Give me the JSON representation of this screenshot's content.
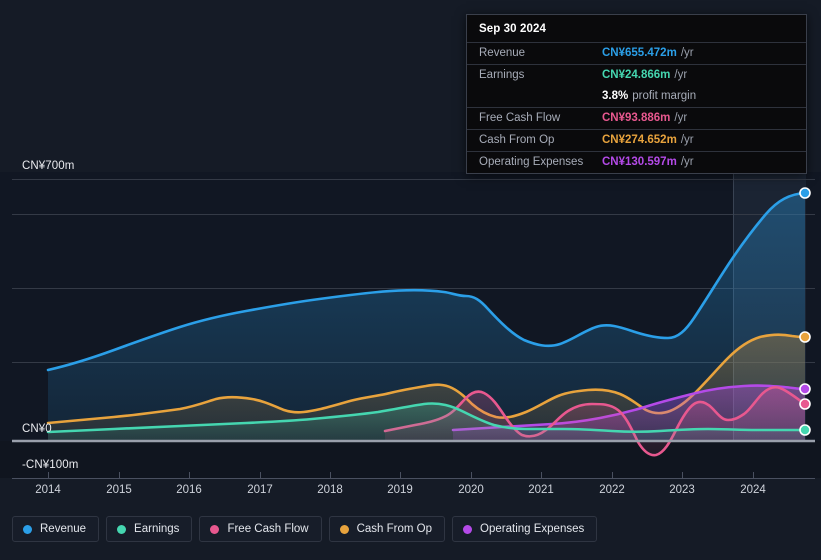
{
  "axis": {
    "y_top_label": "CN¥700m",
    "y_zero_label": "CN¥0",
    "y_bottom_label": "-CN¥100m",
    "x_labels": [
      "2014",
      "2015",
      "2016",
      "2017",
      "2018",
      "2019",
      "2020",
      "2021",
      "2022",
      "2023",
      "2024"
    ]
  },
  "tooltip": {
    "date": "Sep 30 2024",
    "rows": [
      {
        "label": "Revenue",
        "value": "CN¥655.472m",
        "unit": "/yr",
        "color": "#2b9fe8"
      },
      {
        "label": "Earnings",
        "value": "CN¥24.866m",
        "unit": "/yr",
        "color": "#45d6b0"
      },
      {
        "label": "",
        "margin": "3.8%",
        "margin_text": "profit margin"
      },
      {
        "label": "Free Cash Flow",
        "value": "CN¥93.886m",
        "unit": "/yr",
        "color": "#e8588f"
      },
      {
        "label": "Cash From Op",
        "value": "CN¥274.652m",
        "unit": "/yr",
        "color": "#e8a33d"
      },
      {
        "label": "Operating Expenses",
        "value": "CN¥130.597m",
        "unit": "/yr",
        "color": "#b44ae8"
      }
    ]
  },
  "legend": [
    {
      "label": "Revenue",
      "color": "#2b9fe8"
    },
    {
      "label": "Earnings",
      "color": "#45d6b0"
    },
    {
      "label": "Free Cash Flow",
      "color": "#e8588f"
    },
    {
      "label": "Cash From Op",
      "color": "#e8a33d"
    },
    {
      "label": "Operating Expenses",
      "color": "#b44ae8"
    }
  ],
  "chart_data": {
    "type": "area",
    "title": "",
    "xlabel": "",
    "ylabel": "CN¥",
    "ylim": [
      -100,
      700
    ],
    "yticks": [
      -100,
      0,
      200,
      400,
      550,
      700
    ],
    "grid": true,
    "legend_position": "bottom-left",
    "currency": "CN¥",
    "units": "millions per year",
    "x": [
      2014,
      2014.5,
      2015,
      2015.5,
      2016,
      2016.5,
      2017,
      2017.5,
      2018,
      2018.5,
      2019,
      2019.5,
      2020,
      2020.5,
      2021,
      2021.5,
      2022,
      2022.5,
      2023,
      2023.5,
      2024,
      2024.75
    ],
    "forecast_from": 2023.2,
    "series": [
      {
        "name": "Revenue",
        "color": "#2b9fe8",
        "values": [
          166,
          180,
          196,
          212,
          232,
          242,
          252,
          268,
          282,
          292,
          300,
          312,
          322,
          250,
          226,
          256,
          248,
          242,
          300,
          400,
          540,
          655.472
        ]
      },
      {
        "name": "Earnings",
        "color": "#45d6b0",
        "values": [
          3,
          6,
          9,
          12,
          16,
          20,
          24,
          26,
          29,
          32,
          36,
          48,
          54,
          48,
          30,
          26,
          22,
          22,
          22,
          22,
          24,
          24.866
        ]
      },
      {
        "name": "Free Cash Flow",
        "color": "#e8588f",
        "values": [
          null,
          null,
          null,
          null,
          null,
          null,
          null,
          null,
          null,
          16,
          36,
          62,
          108,
          66,
          30,
          104,
          100,
          -22,
          40,
          68,
          32,
          93.886
        ]
      },
      {
        "name": "Cash From Op",
        "color": "#e8a33d",
        "values": [
          32,
          36,
          42,
          48,
          60,
          66,
          62,
          70,
          84,
          78,
          92,
          112,
          122,
          86,
          70,
          116,
          120,
          90,
          110,
          156,
          246,
          274.652
        ]
      },
      {
        "name": "Operating Expenses",
        "color": "#b44ae8",
        "values": [
          null,
          null,
          null,
          null,
          null,
          null,
          null,
          null,
          null,
          null,
          null,
          10,
          14,
          16,
          18,
          24,
          32,
          44,
          62,
          82,
          118,
          130.597
        ]
      }
    ]
  }
}
